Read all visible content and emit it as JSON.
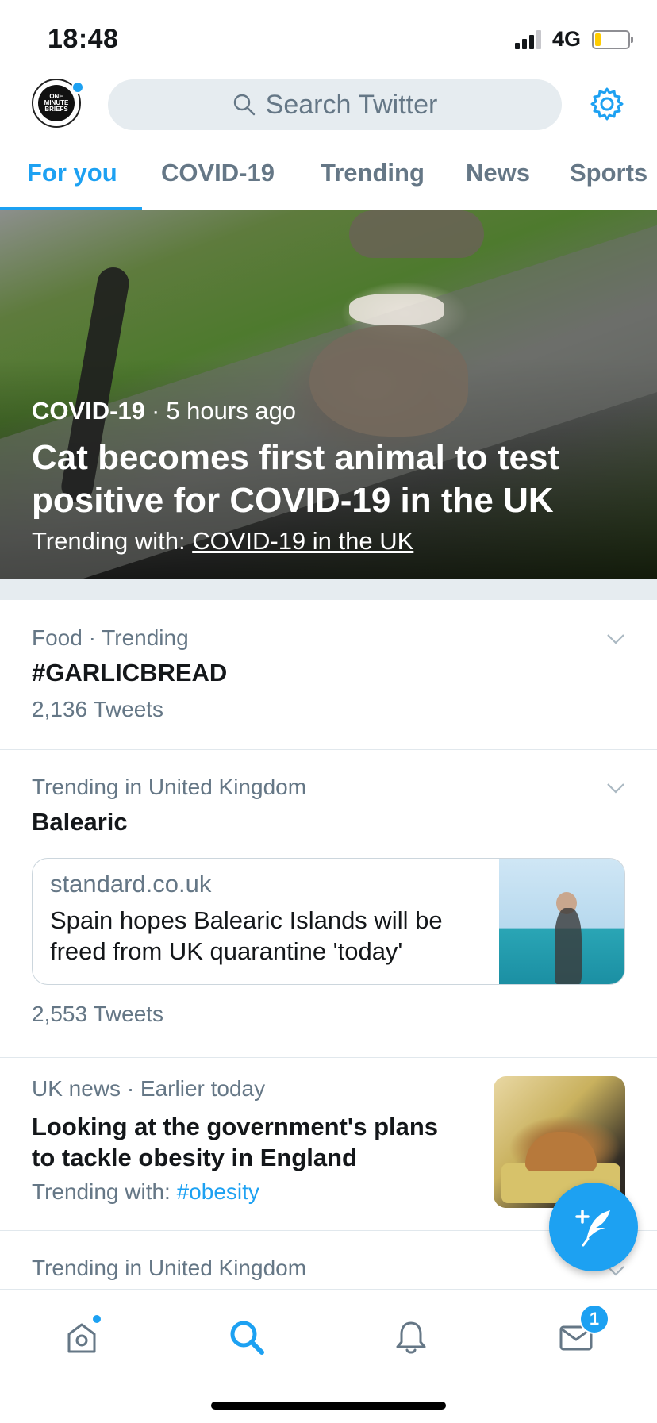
{
  "status_bar": {
    "time": "18:48",
    "network": "4G"
  },
  "header": {
    "avatar_text": "ONE MINUTE BRIEFS",
    "search_placeholder": "Search Twitter"
  },
  "tabs": [
    {
      "label": "For you",
      "active": true
    },
    {
      "label": "COVID-19",
      "active": false
    },
    {
      "label": "Trending",
      "active": false
    },
    {
      "label": "News",
      "active": false
    },
    {
      "label": "Sports",
      "active": false
    }
  ],
  "hero": {
    "category": "COVID-19",
    "separator": "·",
    "time": "5 hours ago",
    "title": "Cat becomes first animal to test positive for COVID-19 in the UK",
    "trending_prefix": "Trending with:",
    "trending_link": "COVID-19 in the UK"
  },
  "trends": [
    {
      "meta": "Food · Trending",
      "headline": "#GARLICBREAD",
      "count": "2,136 Tweets"
    },
    {
      "meta": "Trending in United Kingdom",
      "headline": "Balearic",
      "card": {
        "domain": "standard.co.uk",
        "title": "Spain hopes Balearic Islands will be freed from UK quarantine 'today'"
      },
      "count": "2,553 Tweets"
    },
    {
      "meta": "UK news · Earlier today",
      "headline": "Looking at the government's plans to tackle obesity in England",
      "trending_prefix": "Trending with:",
      "trending_tag": "#obesity"
    },
    {
      "meta": "Trending in United Kingdom"
    }
  ],
  "bottom_nav": {
    "messages_badge": "1"
  },
  "colors": {
    "accent": "#1da1f2",
    "secondary_text": "#657786",
    "divider": "#e1e8ed"
  }
}
